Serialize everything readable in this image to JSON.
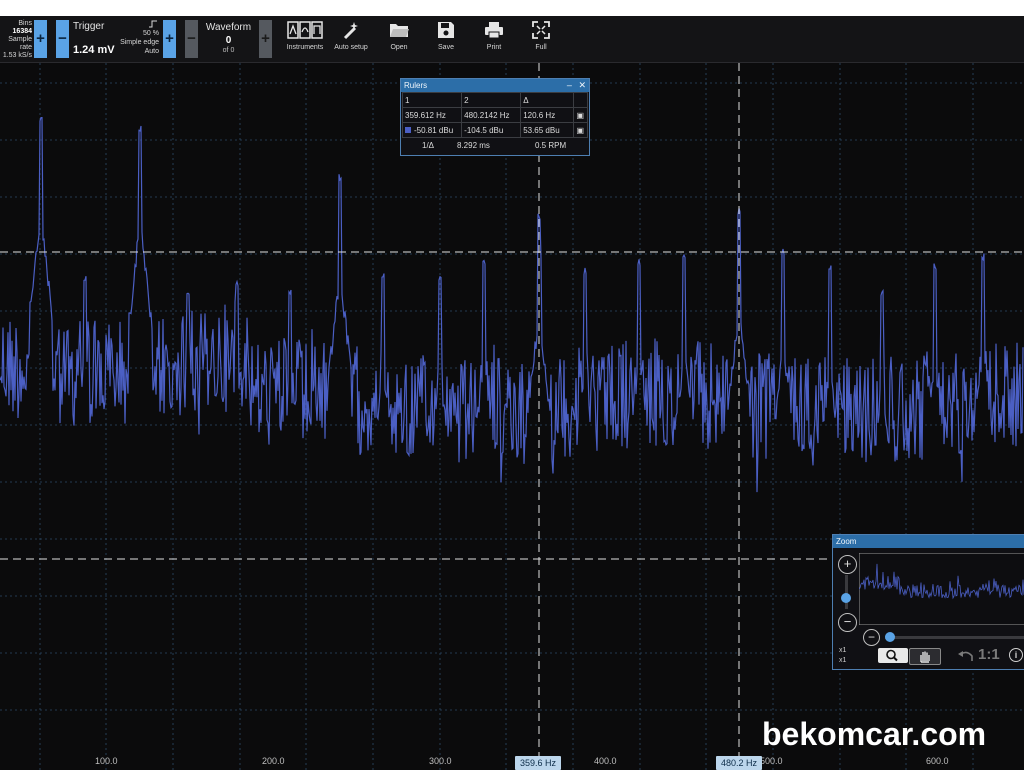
{
  "toolbar": {
    "bins": {
      "label": "Bins",
      "value": "16384",
      "rate_label": "Sample rate",
      "rate_value": "1.53 kS/s"
    },
    "trigger": {
      "label": "Trigger",
      "value": "1.24 mV",
      "percent": "50 %",
      "type": "Simple edge",
      "mode": "Auto"
    },
    "waveform": {
      "label": "Waveform",
      "value": "0",
      "of": "of 0"
    },
    "buttons": [
      {
        "label": "Instruments",
        "icon": "instruments-icon"
      },
      {
        "label": "Auto setup",
        "icon": "wand-icon"
      },
      {
        "label": "Open",
        "icon": "folder-icon"
      },
      {
        "label": "Save",
        "icon": "save-icon"
      },
      {
        "label": "Print",
        "icon": "printer-icon"
      },
      {
        "label": "Full",
        "icon": "fullscreen-icon"
      }
    ],
    "plus": "+",
    "minus": "−"
  },
  "x_axis": {
    "ticks": [
      "100.0",
      "200.0",
      "300.0",
      "400.0",
      "500.0",
      "600.0"
    ]
  },
  "ruler_tags": [
    "359.6 Hz",
    "480.2 Hz"
  ],
  "rulers_panel": {
    "title": "Rulers",
    "col1": "1",
    "col2": "2",
    "delta": "Δ",
    "row_freq": [
      "359.612 Hz",
      "480.2142 Hz",
      "120.6 Hz"
    ],
    "row_level": [
      "-50.81 dBu",
      "-104.5 dBu",
      "53.65 dBu"
    ],
    "inv_label": "1/Δ",
    "period": "8.292 ms",
    "rpm": "0.5 RPM"
  },
  "zoom_panel": {
    "title": "Zoom",
    "plus": "+",
    "minus": "−",
    "x1a": "x1",
    "x1b": "x1",
    "ratio": "1:1"
  },
  "watermark": "bekomcar.com",
  "colors": {
    "trace": "#4b5fc4",
    "accent": "#5aa3e6",
    "panel_header": "#2c6ea8"
  }
}
